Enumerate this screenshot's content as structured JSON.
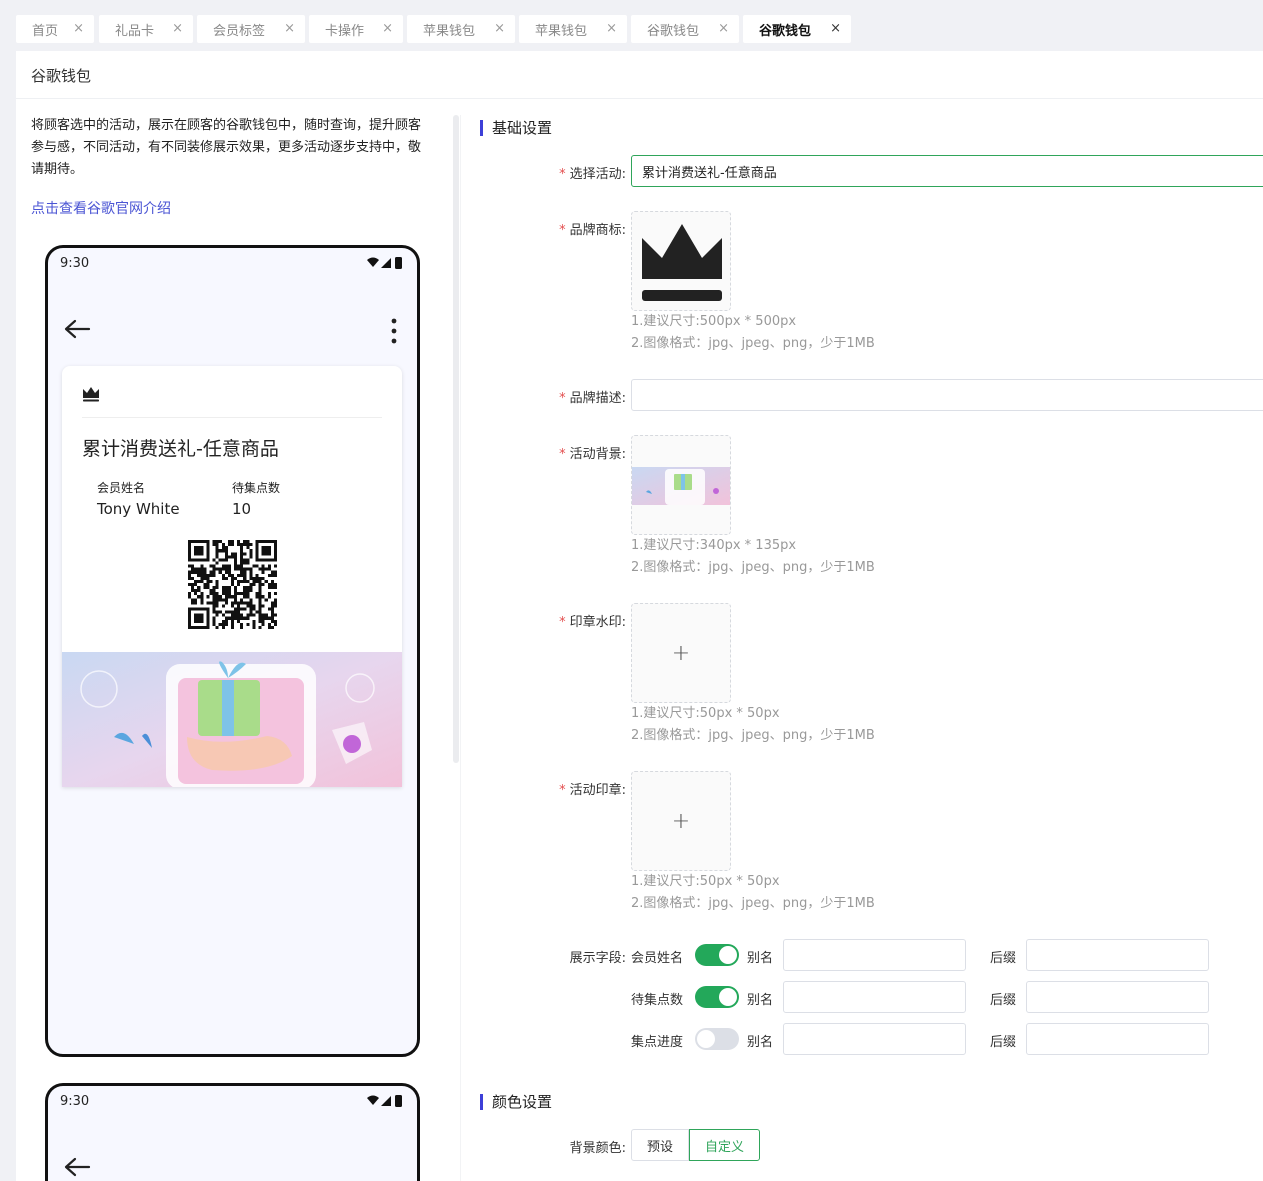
{
  "tabs": [
    {
      "label": "首页",
      "active": false
    },
    {
      "label": "礼品卡",
      "active": false
    },
    {
      "label": "会员标签",
      "active": false
    },
    {
      "label": "卡操作",
      "active": false
    },
    {
      "label": "苹果钱包",
      "active": false
    },
    {
      "label": "苹果钱包",
      "active": false
    },
    {
      "label": "谷歌钱包",
      "active": false
    },
    {
      "label": "谷歌钱包",
      "active": true
    }
  ],
  "tab_close_glyph": "×",
  "page": {
    "title": "谷歌钱包",
    "intro": "将顾客选中的活动，展示在顾客的谷歌钱包中，随时查询，提升顾客参与感，不同活动，有不同装修展示效果，更多活动逐步支持中，敬请期待。",
    "intro_link": "点击查看谷歌官网介绍"
  },
  "preview": {
    "status_time": "9:30",
    "pass_title": "累计消费送礼-任意商品",
    "fields": [
      {
        "label": "会员姓名",
        "value": "Tony White"
      },
      {
        "label": "待集点数",
        "value": "10"
      }
    ],
    "second_status_time": "9:30"
  },
  "form": {
    "basic_section": "基础设置",
    "activity_label": "选择活动:",
    "activity_value": "累计消费送礼-任意商品",
    "logo_label": "品牌商标:",
    "logo_hints": [
      "1.建议尺寸:500px * 500px",
      "2.图像格式：jpg、jpeg、png，少于1MB"
    ],
    "desc_label": "品牌描述:",
    "desc_value": "",
    "bg_label": "活动背景:",
    "bg_hints": [
      "1.建议尺寸:340px * 135px",
      "2.图像格式：jpg、jpeg、png，少于1MB"
    ],
    "watermark_label": "印章水印:",
    "watermark_hints": [
      "1.建议尺寸:50px * 50px",
      "2.图像格式：jpg、jpeg、png，少于1MB"
    ],
    "stamp_label": "活动印章:",
    "stamp_hints": [
      "1.建议尺寸:50px * 50px",
      "2.图像格式：jpg、jpeg、png，少于1MB"
    ],
    "upload_plus": "+",
    "display_fields_label": "展示字段:",
    "display_fields": [
      {
        "name": "会员姓名",
        "enabled": true,
        "alias_label": "别名",
        "suffix_label": "后缀"
      },
      {
        "name": "待集点数",
        "enabled": true,
        "alias_label": "别名",
        "suffix_label": "后缀"
      },
      {
        "name": "集点进度",
        "enabled": false,
        "alias_label": "别名",
        "suffix_label": "后缀"
      }
    ],
    "color_section": "颜色设置",
    "bg_color_label": "背景颜色:",
    "bg_color_options": [
      "预设",
      "自定义"
    ],
    "bg_color_selected": "自定义",
    "required_mark": "*"
  },
  "colors": {
    "accent_green": "#23a85a",
    "section_bar": "#3d3fd8",
    "link": "#4b55d4",
    "required": "#e34d4d"
  }
}
